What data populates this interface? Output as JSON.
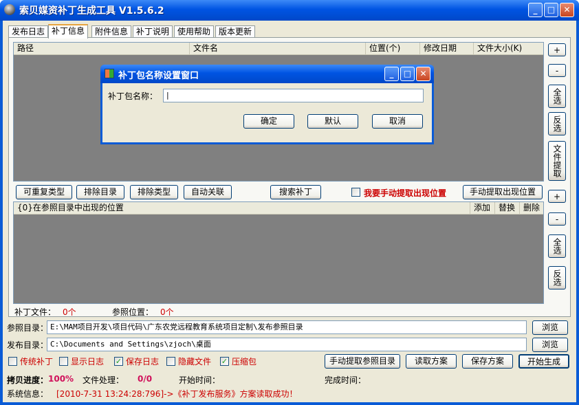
{
  "window": {
    "title": "索贝媒资补丁生成工具 V1.5.6.2",
    "min": "_",
    "max": "□",
    "close": "✕"
  },
  "tabs": [
    "发布日志",
    "补丁信息",
    "附件信息",
    "补丁说明",
    "使用帮助",
    "版本更新"
  ],
  "file_list": {
    "columns": [
      "路径",
      "文件名",
      "位置(个)",
      "修改日期",
      "文件大小(K)"
    ]
  },
  "mid_buttons": {
    "repeatable_type": "可重复类型",
    "exclude_dir": "排除目录",
    "exclude_type": "排除类型",
    "auto_link": "自动关联",
    "search_patch": "搜索补丁",
    "manual_extract_label": "我要手动提取出现位置",
    "manual_extract_btn": "手动提取出现位置"
  },
  "side_buttons_top": {
    "add": "+",
    "remove": "-",
    "select_all": "全选",
    "invert": "反选",
    "extract": "文件提取"
  },
  "side_buttons_bottom": {
    "add": "+",
    "remove": "-",
    "select_all": "全选",
    "invert": "反选"
  },
  "pos_list": {
    "columns": [
      "{0}在参照目录中出现的位置",
      "添加",
      "替换",
      "删除"
    ]
  },
  "counts": {
    "patch_files_label": "补丁文件：",
    "patch_files_value": "0个",
    "ref_pos_label": "参照位置：",
    "ref_pos_value": "0个"
  },
  "ref_dir": {
    "label": "参照目录：",
    "value": "E:\\MAM项目开发\\项目代码\\广东农党远程教育系统项目定制\\发布参照目录",
    "browse": "浏览"
  },
  "pub_dir": {
    "label": "发布目录：",
    "value": "C:\\Documents and Settings\\zjoch\\桌面",
    "browse": "浏览"
  },
  "options": [
    {
      "label": "传统补丁",
      "checked": false
    },
    {
      "label": "显示日志",
      "checked": false
    },
    {
      "label": "保存日志",
      "checked": true
    },
    {
      "label": "隐藏文件",
      "checked": false
    },
    {
      "label": "压缩包",
      "checked": true
    }
  ],
  "actions": {
    "manual_ref": "手动提取参照目录",
    "read_scheme": "读取方案",
    "save_scheme": "保存方案",
    "start": "开始生成"
  },
  "status": {
    "copy_label": "拷贝进度：",
    "copy_value": "100%",
    "file_label": "文件处理：",
    "file_value": "0/0",
    "start_label": "开始时间：",
    "end_label": "完成时间：",
    "sys_label": "系统信息：",
    "sys_value": "[2010-7-31 13:24:28:796]->《补丁发布服务》方案读取成功！"
  },
  "dialog": {
    "title": "补丁包名称设置窗口",
    "name_label": "补丁包名称：",
    "name_value": "",
    "ok": "确定",
    "default": "默认",
    "cancel": "取消"
  },
  "colors": {
    "titlebar": "#0054e3",
    "face": "#ece9d8",
    "list_bg": "#808080",
    "accent_red": "#cc0000",
    "checked": "#21a121"
  }
}
